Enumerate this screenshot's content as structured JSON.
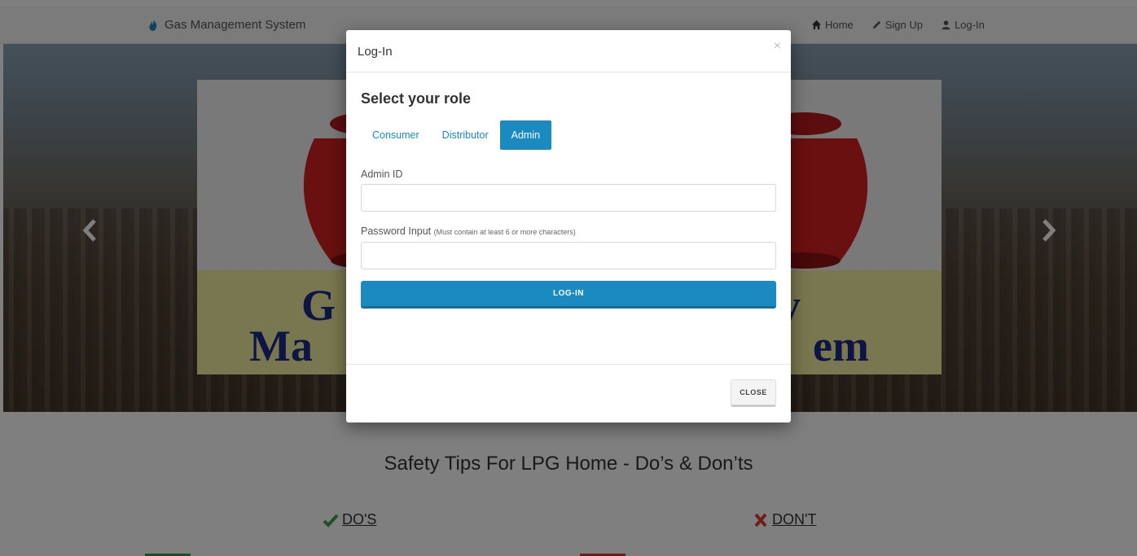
{
  "navbar": {
    "brand": "Gas Management System",
    "links": [
      {
        "label": "Home",
        "icon": "home-icon"
      },
      {
        "label": "Sign Up",
        "icon": "pencil-icon"
      },
      {
        "label": "Log-In",
        "icon": "user-icon"
      }
    ]
  },
  "carousel": {
    "banner_text": {
      "line1_left": "G",
      "line1_right": "y",
      "line2_left": "Ma",
      "line2_right": "em"
    }
  },
  "tips": {
    "heading": "Safety Tips For LPG Home - Do’s & Don’ts",
    "dos_label": "DO'S",
    "donts_label": "DON'T"
  },
  "modal": {
    "title": "Log-In",
    "close_symbol": "×",
    "role_heading": "Select your role",
    "role_tabs": [
      {
        "label": "Consumer",
        "active": false
      },
      {
        "label": "Distributor",
        "active": false
      },
      {
        "label": "Admin",
        "active": true
      }
    ],
    "admin_id_label": "Admin ID",
    "admin_id_value": "",
    "password_label": "Password Input",
    "password_hint": "(Must contain at least 6 or more characters)",
    "password_value": "",
    "login_button": "LOG-IN",
    "close_button": "CLOSE"
  },
  "colors": {
    "accent": "#1a8ac0",
    "navbar_bg": "#f6f6f6",
    "banner_yellow": "#f2ee9e",
    "banner_text": "#1c2a8a",
    "dos_green": "#3aa04a",
    "donts_red": "#d9412e"
  }
}
